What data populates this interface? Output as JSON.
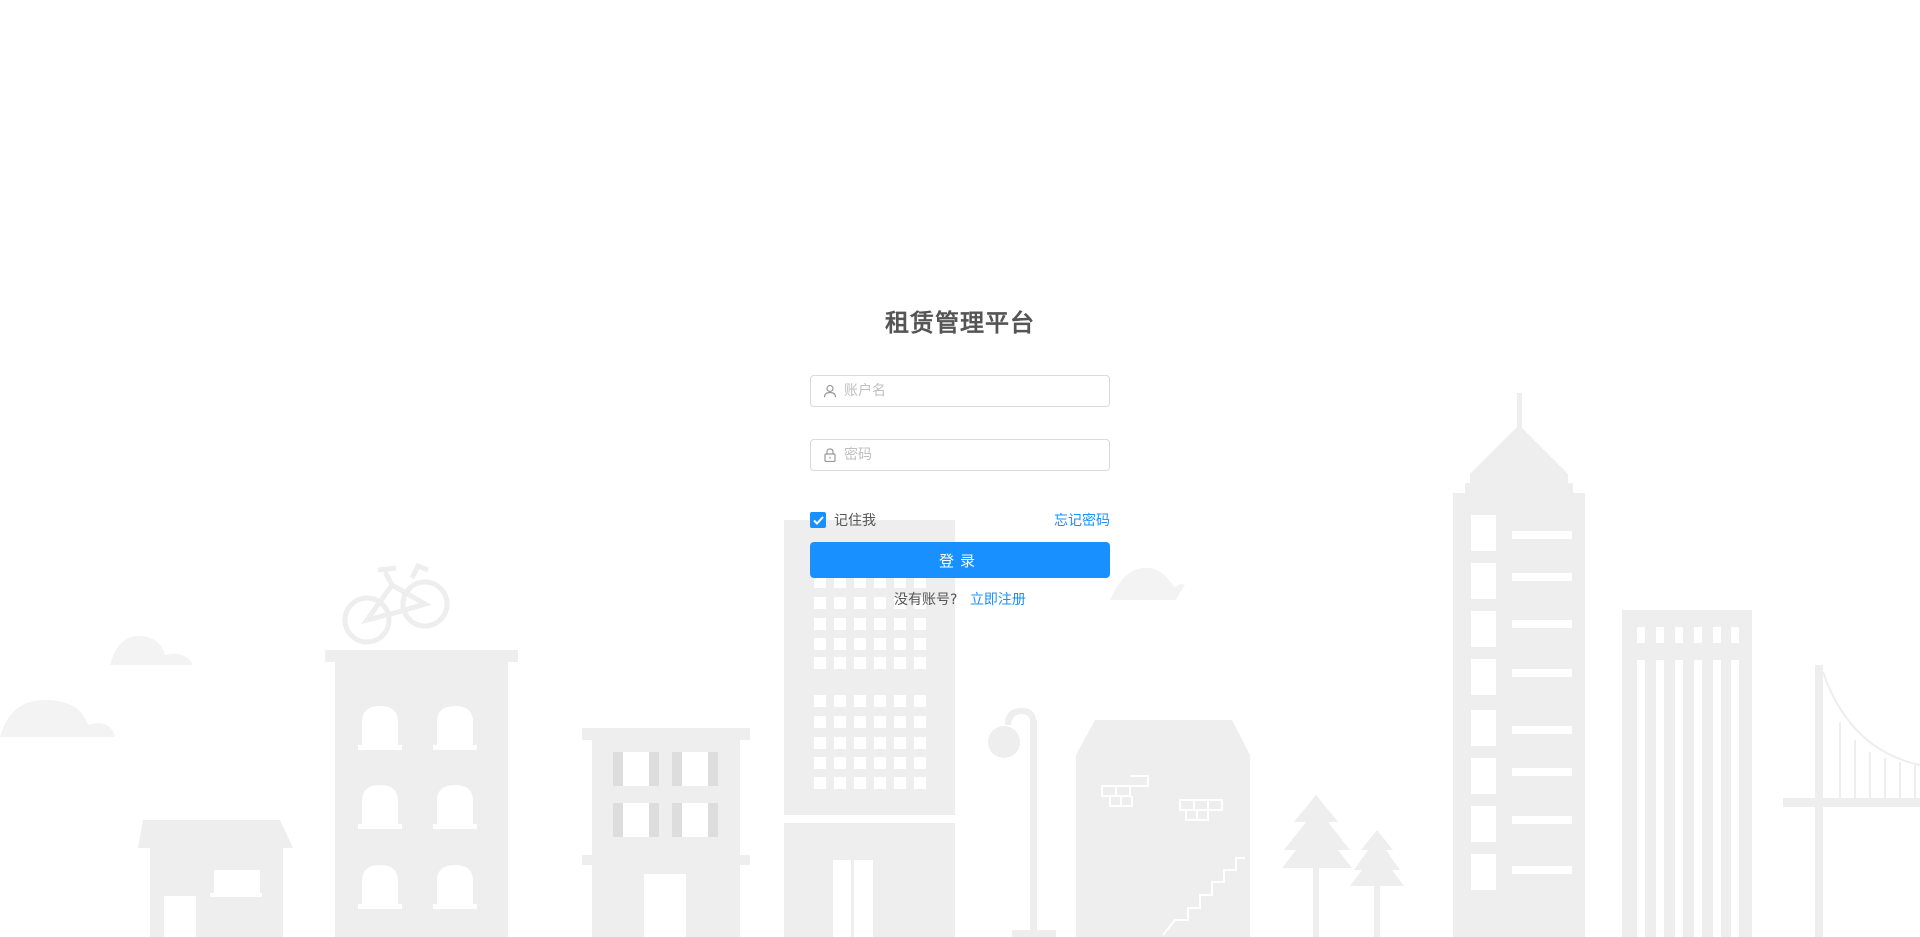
{
  "app": {
    "title": "租赁管理平台"
  },
  "form": {
    "username": {
      "value": "",
      "placeholder": "账户名",
      "icon": "user-icon"
    },
    "password": {
      "value": "",
      "placeholder": "密码",
      "icon": "lock-icon"
    },
    "remember": {
      "label": "记住我",
      "checked": true
    },
    "forgot_label": "忘记密码",
    "login_label": "登录",
    "register_prompt": "没有账号?",
    "register_link": "立即注册"
  },
  "colors": {
    "primary": "#1890ff",
    "background_art": "#eeeeee",
    "cloud": "#f3f3f3"
  }
}
